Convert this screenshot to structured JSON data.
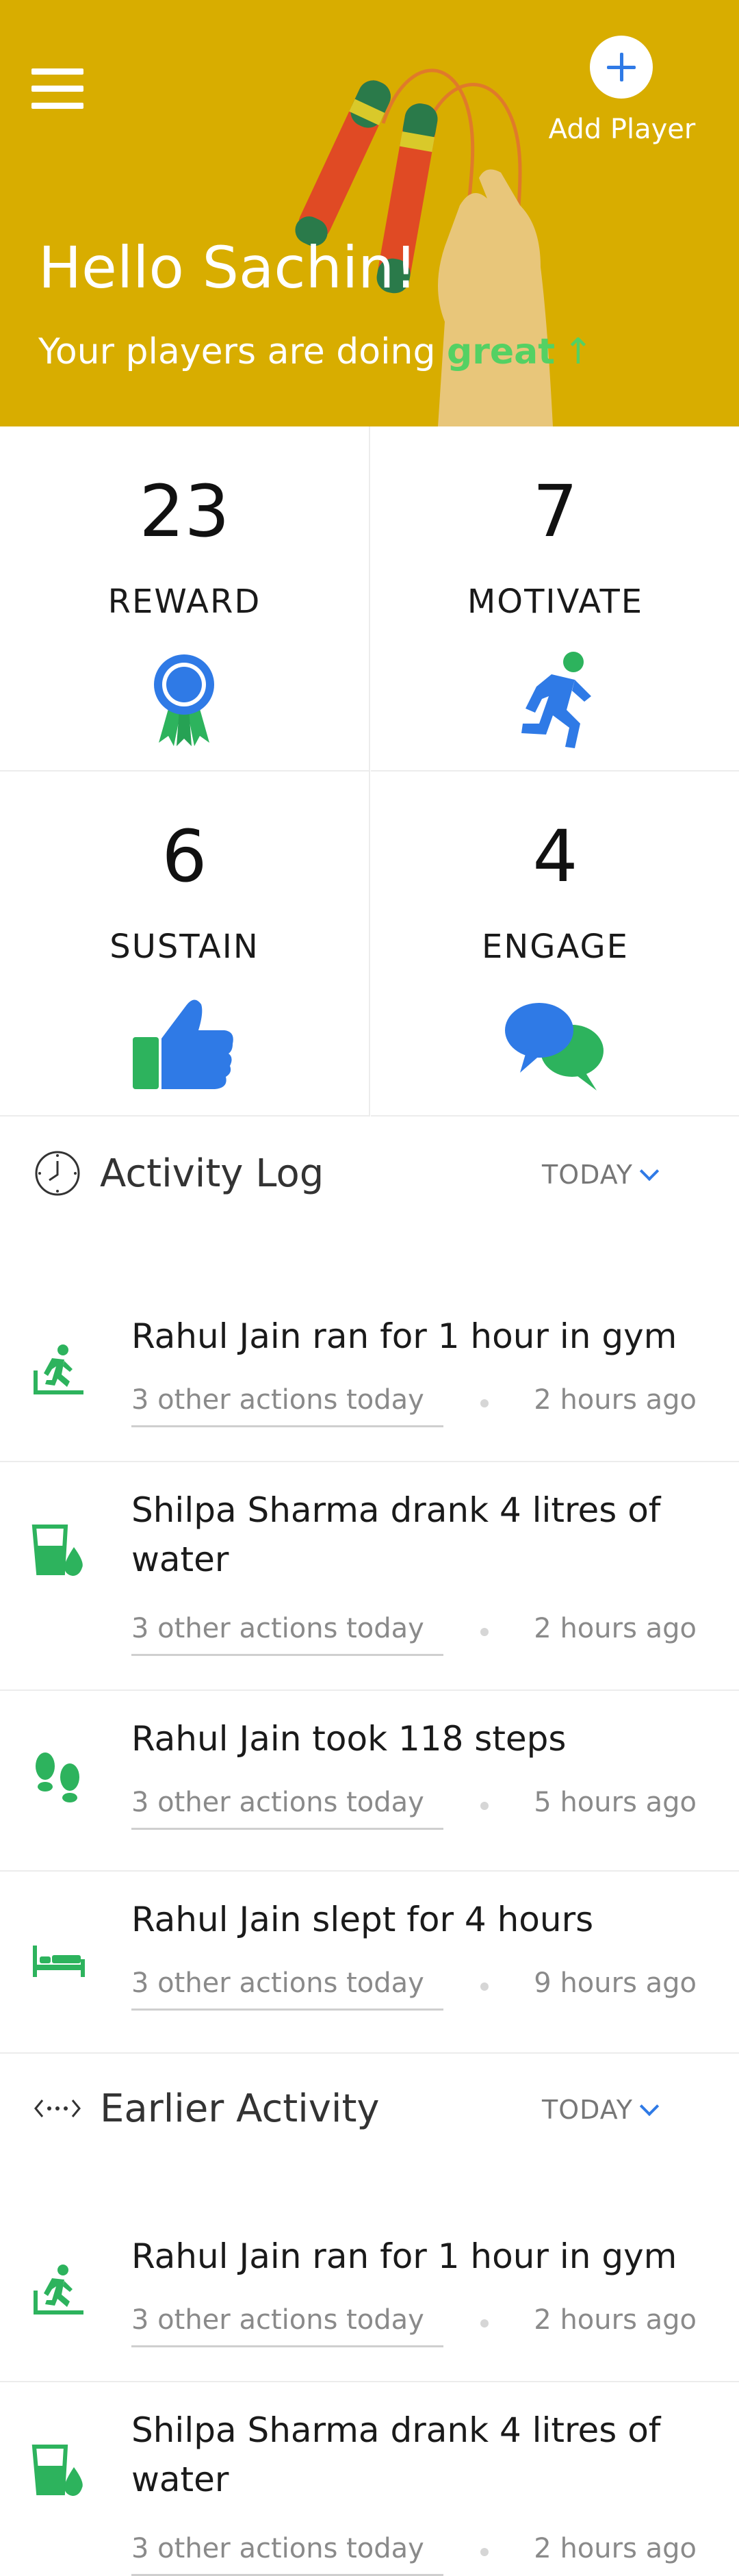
{
  "header": {
    "add_label": "Add Player",
    "greeting": "Hello Sachin!",
    "subtitle_prefix": "Your players are doing ",
    "subtitle_emphasis": "great",
    "subtitle_arrow": "↑",
    "accent_color": "#d8ad00"
  },
  "stats": [
    {
      "value": "23",
      "label": "REWARD",
      "icon": "ribbon-award-icon"
    },
    {
      "value": "7",
      "label": "MOTIVATE",
      "icon": "running-person-icon"
    },
    {
      "value": "6",
      "label": "SUSTAIN",
      "icon": "thumbs-up-icon"
    },
    {
      "value": "4",
      "label": "ENGAGE",
      "icon": "chat-bubbles-icon"
    }
  ],
  "activity_log": {
    "title": "Activity Log",
    "filter": "TODAY",
    "items": [
      {
        "text": "Rahul Jain ran for 1 hour in gym",
        "meta": "3 other actions today",
        "ago": "2 hours ago",
        "icon": "treadmill-icon"
      },
      {
        "text": "Shilpa Sharma drank 4 litres of water",
        "meta": "3 other actions today",
        "ago": "2 hours ago",
        "icon": "water-glass-icon"
      },
      {
        "text": "Rahul Jain took 118 steps",
        "meta": "3 other actions today",
        "ago": "5 hours ago",
        "icon": "footsteps-icon"
      },
      {
        "text": "Rahul Jain slept for 4 hours",
        "meta": "3 other actions today",
        "ago": "9 hours ago",
        "icon": "bed-icon"
      }
    ]
  },
  "earlier_activity": {
    "title": "Earlier Activity",
    "filter": "TODAY",
    "items": [
      {
        "text": "Rahul Jain ran for 1 hour in gym",
        "meta": "3 other actions today",
        "ago": "2 hours ago",
        "icon": "treadmill-icon"
      },
      {
        "text": "Shilpa Sharma drank 4 litres of water",
        "meta": "3 other actions today",
        "ago": "2 hours ago",
        "icon": "water-glass-icon"
      }
    ]
  },
  "colors": {
    "green": "#2db35d",
    "blue": "#2f7ae6",
    "yellow": "#d8ad00"
  }
}
